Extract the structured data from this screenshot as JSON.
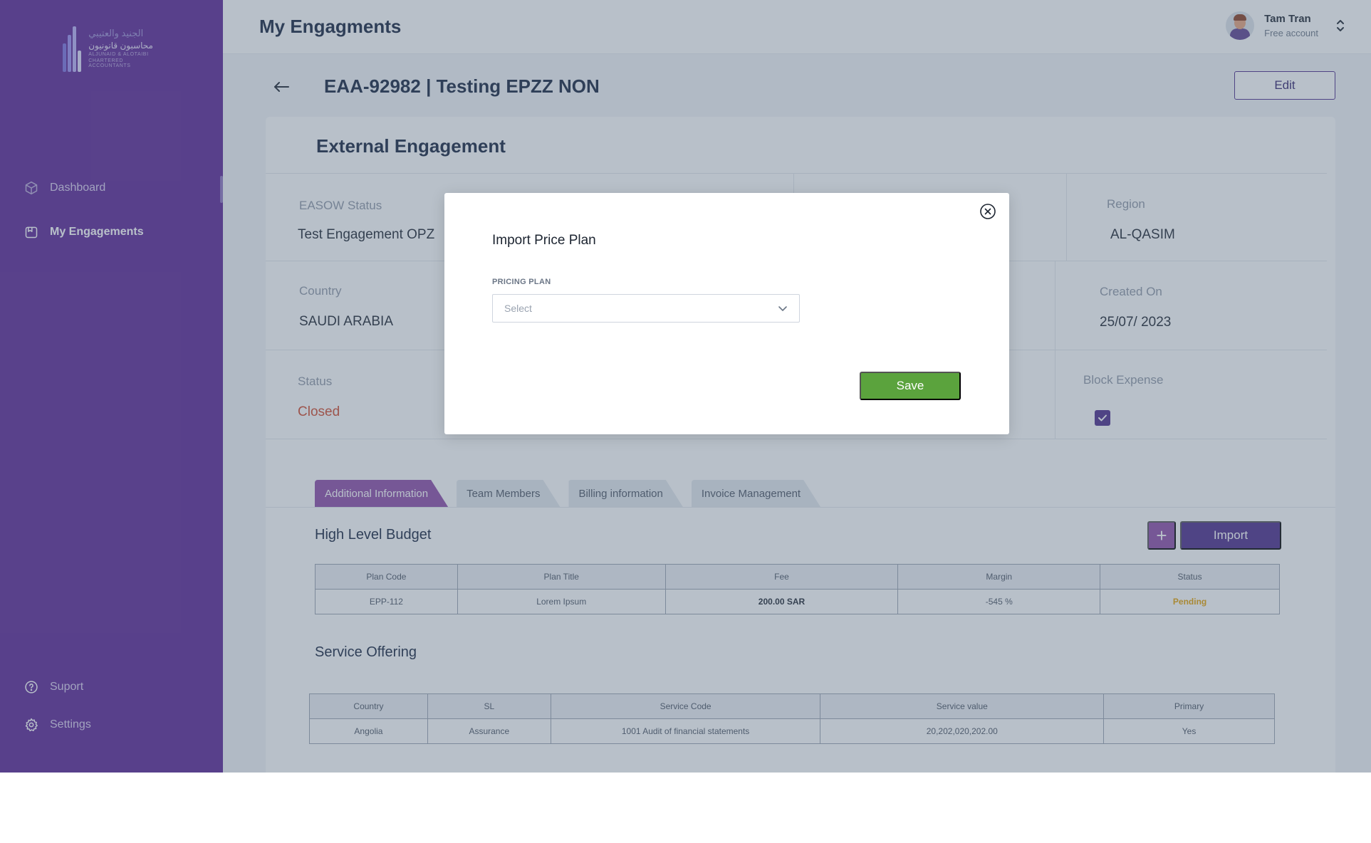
{
  "app": {
    "logo": {
      "arabic_line1": "الجنيد والعتيبي",
      "arabic_line2": "محاسبون قانونيون",
      "english_line1": "ALJUNAID & ALOTAIBI",
      "english_line2": "CHARTERED ACCOUNTANTS"
    }
  },
  "sidebar": {
    "items": [
      {
        "label": "Dashboard",
        "icon": "cube-icon",
        "active": false
      },
      {
        "label": "My Engagements",
        "icon": "folder-icon",
        "active": true
      }
    ],
    "bottom_items": [
      {
        "label": "Suport",
        "icon": "help-circle-icon"
      },
      {
        "label": "Settings",
        "icon": "gear-icon"
      }
    ]
  },
  "header": {
    "title": "My Engagments",
    "user": {
      "name": "Tam Tran",
      "plan": "Free account"
    }
  },
  "engagement": {
    "title": "EAA-92982 | Testing EPZZ NON",
    "edit_label": "Edit",
    "card_title": "External Engagement",
    "fields": {
      "easow_status": {
        "label": "EASOW Status",
        "value": "Test Engagement OPZ"
      },
      "region": {
        "label": "Region",
        "value": "AL-QASIM"
      },
      "country": {
        "label": "Country",
        "value": "SAUDI ARABIA"
      },
      "created_on": {
        "label": "Created On",
        "value": "25/07/ 2023"
      },
      "status": {
        "label": "Status",
        "value": "Closed"
      },
      "block_expense": {
        "label": "Block Expense",
        "checked": true
      }
    }
  },
  "tabs": [
    {
      "label": "Additional Information",
      "active": true
    },
    {
      "label": "Team Members",
      "active": false
    },
    {
      "label": "Billing information",
      "active": false
    },
    {
      "label": "Invoice Management",
      "active": false
    }
  ],
  "budget": {
    "title": "High Level Budget",
    "add_label": "+",
    "import_label": "Import",
    "columns": [
      "Plan Code",
      "Plan Title",
      "Fee",
      "Margin",
      "Status"
    ],
    "rows": [
      {
        "plan_code": "EPP-112",
        "plan_title": "Lorem Ipsum",
        "fee": "200.00 SAR",
        "margin": "-545 %",
        "status": "Pending"
      }
    ]
  },
  "service": {
    "title": "Service Offering",
    "columns": [
      "Country",
      "SL",
      "Service Code",
      "Service value",
      "Primary"
    ],
    "rows": [
      {
        "country": "Angolia",
        "sl": "Assurance",
        "service_code": "1001 Audit of financial statements",
        "service_value": "20,202,020,202.00",
        "primary": "Yes"
      }
    ]
  },
  "modal": {
    "title": "Import Price Plan",
    "field_label": "PRICING PLAN",
    "select_placeholder": "Select",
    "save_label": "Save"
  },
  "colors": {
    "sidebar_bg": "#5b2494",
    "accent_purple": "#4b2a8a",
    "tab_active": "#8e4aa8",
    "save_green": "#5ba33d",
    "status_closed": "#d0472a",
    "status_pending": "#e5a000"
  }
}
